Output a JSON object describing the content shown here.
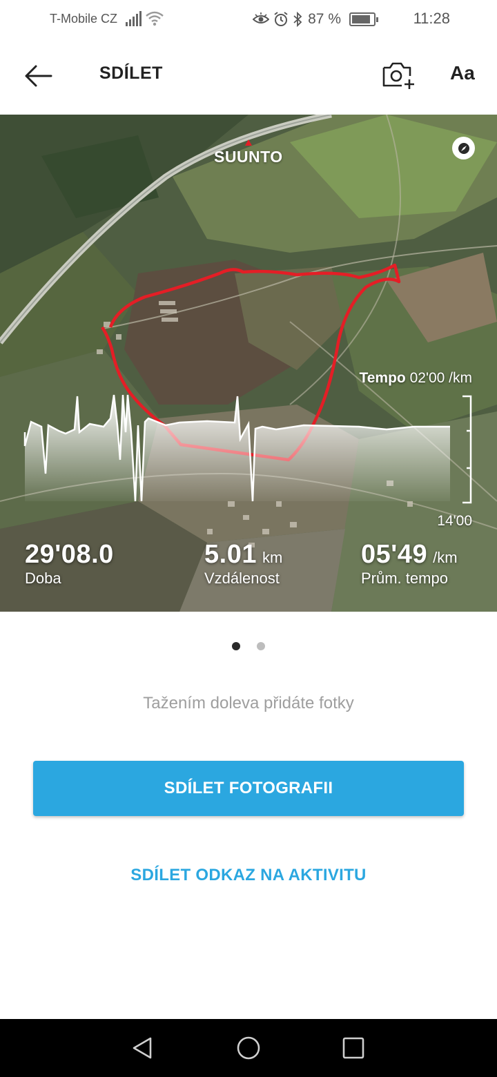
{
  "status_bar": {
    "carrier": "T-Mobile CZ",
    "battery": "87 %",
    "battery_level": 0.87,
    "time": "11:28",
    "icons": [
      "signal-icon",
      "wifi-icon",
      "eye-icon",
      "alarm-icon",
      "bluetooth-icon",
      "battery-icon"
    ]
  },
  "app_bar": {
    "title": "SDÍLET",
    "font_button": "Aa",
    "icons": [
      "back-arrow-icon",
      "add-photo-icon"
    ]
  },
  "share_card": {
    "brand": "SUUNTO",
    "route_color": "#e41e26",
    "tempo_label": "Tempo",
    "tempo_top": "02'00 /km",
    "tempo_bottom": "14'00",
    "stats": [
      {
        "value": "29'08.0",
        "unit": "",
        "label": "Doba"
      },
      {
        "value": "5.01",
        "unit": "km",
        "label": "Vzdálenost"
      },
      {
        "value": "05'49",
        "unit": "/km",
        "label": "Prům. tempo"
      }
    ]
  },
  "pager": {
    "count": 2,
    "active": 0
  },
  "hint": "Tažením doleva přidáte fotky",
  "buttons": {
    "share_photo": "SDÍLET FOTOGRAFII",
    "share_link": "SDÍLET ODKAZ NA AKTIVITU",
    "accent_color": "#2ba7e0"
  },
  "nav_bar": {
    "icons": [
      "back-triangle-icon",
      "home-circle-icon",
      "recents-square-icon"
    ]
  }
}
